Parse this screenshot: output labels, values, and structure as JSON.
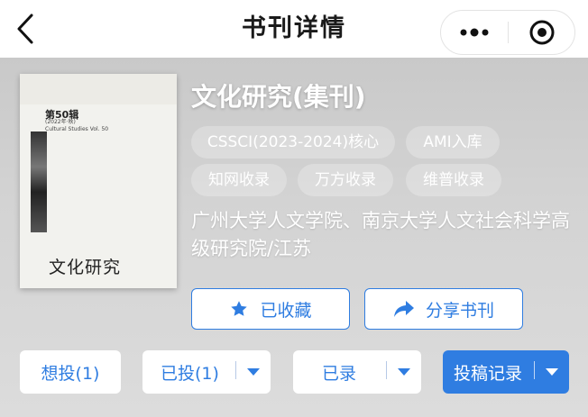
{
  "header": {
    "title": "书刊详情",
    "back_icon": "back-chevron-icon",
    "more_icon": "more-dots-icon",
    "close_icon": "target-close-icon"
  },
  "journal": {
    "title": "文化研究(集刊)",
    "tags": [
      "CSSCI(2023-2024)核心",
      "AMI入库",
      "知网收录",
      "万方收录",
      "维普收录"
    ],
    "affiliation": "广州大学人文学院、南京大学人文社会科学高级研究院/江苏",
    "cover": {
      "volume": "第50辑",
      "volume_sub": "(2022年·秋)",
      "english": "Cultural Studies Vol. 50",
      "title": "文化研究"
    }
  },
  "actions": {
    "favorite_label": "已收藏",
    "share_label": "分享书刊",
    "want_label": "想投(1)",
    "submitted_label": "已投(1)",
    "accepted_label": "已录",
    "record_label": "投稿记录"
  },
  "colors": {
    "accent": "#2f7de1",
    "hero_bg": "#cfcfcf"
  }
}
